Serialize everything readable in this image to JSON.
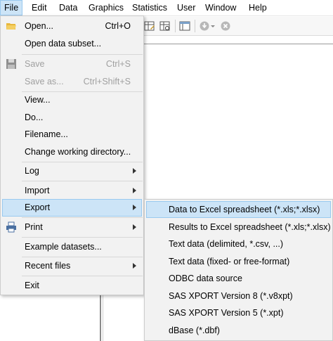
{
  "menubar": {
    "items": [
      "File",
      "Edit",
      "Data",
      "Graphics",
      "Statistics",
      "User",
      "Window",
      "Help"
    ]
  },
  "file_menu": {
    "open": {
      "label": "Open...",
      "shortcut": "Ctrl+O"
    },
    "open_subset": {
      "label": "Open data subset..."
    },
    "save": {
      "label": "Save",
      "shortcut": "Ctrl+S"
    },
    "save_as": {
      "label": "Save as...",
      "shortcut": "Ctrl+Shift+S"
    },
    "view": {
      "label": "View..."
    },
    "do": {
      "label": "Do..."
    },
    "filename": {
      "label": "Filename..."
    },
    "change_dir": {
      "label": "Change working directory..."
    },
    "log": {
      "label": "Log"
    },
    "import": {
      "label": "Import"
    },
    "export": {
      "label": "Export"
    },
    "print": {
      "label": "Print"
    },
    "example": {
      "label": "Example datasets..."
    },
    "recent": {
      "label": "Recent files"
    },
    "exit": {
      "label": "Exit"
    }
  },
  "export_submenu": {
    "items": [
      "Data to Excel spreadsheet (*.xls;*.xlsx)",
      "Results to Excel spreadsheet (*.xls;*.xlsx)",
      "Text data (delimited, *.csv, ...)",
      "Text data (fixed- or free-format)",
      "ODBC data source",
      "SAS XPORT Version 8 (*.v8xpt)",
      "SAS XPORT Version 5 (*.xpt)",
      "dBase (*.dbf)"
    ]
  },
  "colors": {
    "highlight": "#cce4f7",
    "highlight_border": "#99c9ef",
    "menu_bg": "#f2f2f2",
    "disabled_text": "#a0a0a0"
  }
}
